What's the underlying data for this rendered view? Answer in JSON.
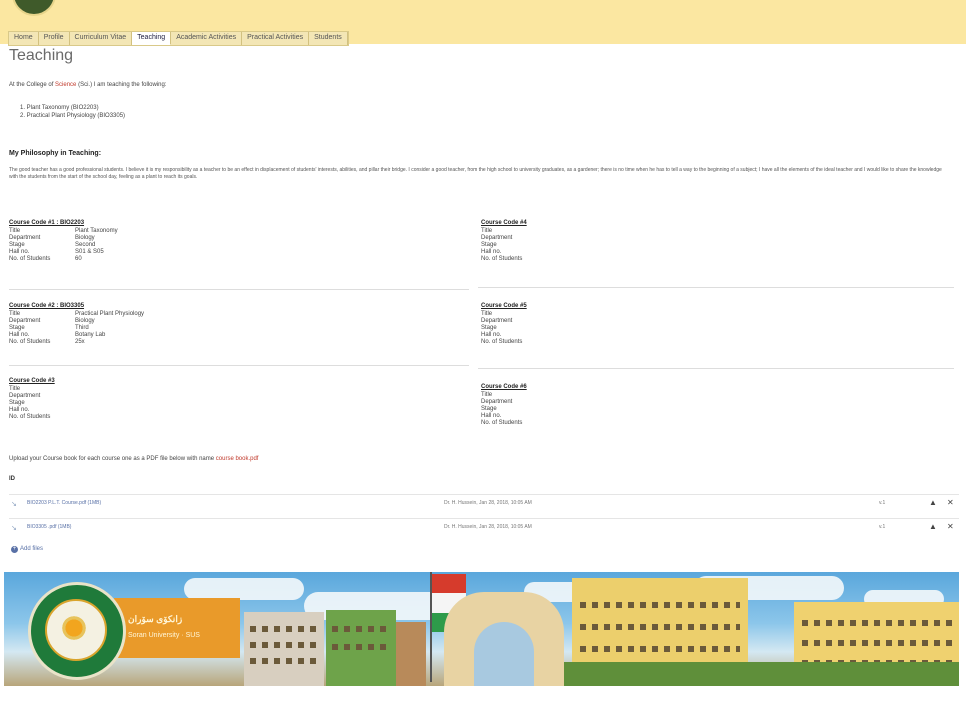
{
  "nav": {
    "tabs": [
      "Home",
      "Profile",
      "Curriculum Vitae",
      "Teaching",
      "Academic Activities",
      "Practical Activities",
      "Students"
    ],
    "active_index": 3
  },
  "page": {
    "title": "Teaching",
    "intro_prefix": "At the College of",
    "intro_college": "Science",
    "intro_suffix": "(Sci.) I am teaching the following:",
    "courses": [
      "1. Plant Taxonomy (BIO2203)",
      "2. Practical Plant Physiology (BIO3305)"
    ],
    "philosophy_heading": "My Philosophy in Teaching:",
    "philosophy_text": "The good teacher has a good professional students. I believe it is my responsibility as a teacher to be an effect in displacement of students' interests, abilities, and pillar their bridge. I consider a good teacher, from the high school to university graduates, as a gardener; there is no time when he has to tell a way to the beginning of a subject; I have all the elements of the ideal teacher and I would like to share the knowledge with the students from the start of the school day, feeling as a plant to reach its goals."
  },
  "course_fields": [
    "Title",
    "Department",
    "Stage",
    "Hall no.",
    "No. of Students"
  ],
  "course_blocks": [
    {
      "code": "Course Code #1 : BIO2203",
      "values": [
        "Plant Taxonomy",
        "Biology",
        "Second",
        "S01 & S05",
        "60"
      ]
    },
    {
      "code": "Course Code #4",
      "values": [
        "",
        "",
        "",
        "",
        ""
      ]
    },
    {
      "code": "Course Code #2 : BIO3305",
      "values": [
        "Practical Plant Physiology",
        "Biology",
        "Third",
        "Botany Lab",
        "25x"
      ]
    },
    {
      "code": "Course Code #5",
      "values": [
        "",
        "",
        "",
        "",
        ""
      ]
    },
    {
      "code": "Course Code #3",
      "values": [
        "",
        "",
        "",
        "",
        ""
      ]
    },
    {
      "code": "Course Code #6",
      "values": [
        "",
        "",
        "",
        "",
        ""
      ]
    }
  ],
  "upload": {
    "note_prefix": "Upload your Course book for each course one as a PDF file below with name",
    "note_link": "course book.pdf",
    "files_label": "ID",
    "files": [
      {
        "name": "BIO2203 P.L.T. Course.pdf",
        "size": "(1MB)",
        "meta": "Dr. H. Hussein, Jan 28, 2018, 10:05 AM",
        "version": "v.1"
      },
      {
        "name": "BIO3305 .pdf",
        "size": "(1MB)",
        "meta": "Dr. H. Hussein, Jan 28, 2018, 10:05 AM",
        "version": "v.1"
      }
    ],
    "add_files_label": "Add files"
  },
  "banner": {
    "line1": "زانكۆی سۆران",
    "line2": "Soran University · SUS",
    "seal_color": "#1f7a3a",
    "plate_color": "#e99a2a"
  }
}
